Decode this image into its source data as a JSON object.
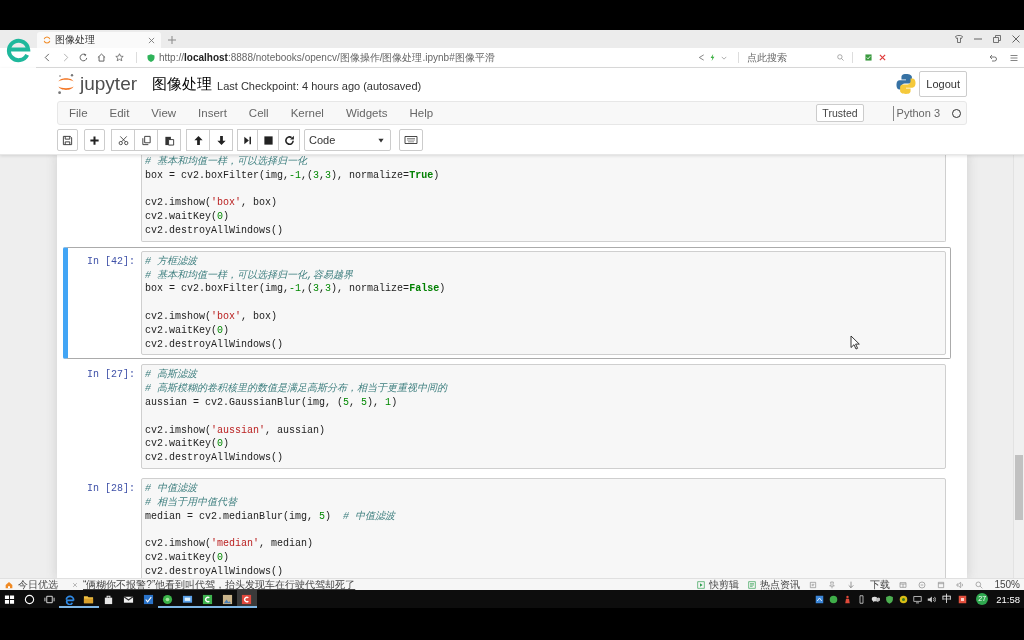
{
  "browser": {
    "tab": {
      "title": "图像处理"
    },
    "url": "http://**localhost**:8888/notebooks/opencv/图像操作/图像处理.ipynb#图像平滑",
    "search": {
      "placeholder": "点此搜索"
    }
  },
  "notebook": {
    "brand": "jupyter",
    "title": "图像处理",
    "checkpoint": "Last Checkpoint: 4 hours ago (autosaved)",
    "logout": "Logout",
    "menu": [
      "File",
      "Edit",
      "View",
      "Insert",
      "Cell",
      "Kernel",
      "Widgets",
      "Help"
    ],
    "trusted": "Trusted",
    "kernel": {
      "name": "Python 3",
      "busy": false
    },
    "cell_type": "Code"
  },
  "cells": [
    {
      "selected": false,
      "code": [
        [
          [
            {
              "kind": "comment",
              "text": "# 基本和均值一样，可以选择归一化"
            }
          ],
          [
            {
              "kind": "plain",
              "text": "box = cv2.boxFilter(img,"
            },
            {
              "kind": "number",
              "text": "-1"
            },
            {
              "kind": "plain",
              "text": ",("
            },
            {
              "kind": "number",
              "text": "3"
            },
            {
              "kind": "plain",
              "text": ","
            },
            {
              "kind": "number",
              "text": "3"
            },
            {
              "kind": "plain",
              "text": "), normalize="
            },
            {
              "kind": "keyword",
              "text": "True"
            },
            {
              "kind": "plain",
              "text": ")"
            }
          ]
        ],
        [
          [
            {
              "kind": "plain",
              "text": "cv2.imshow("
            },
            {
              "kind": "string",
              "text": "'box'"
            },
            {
              "kind": "plain",
              "text": ", box)"
            }
          ],
          [
            {
              "kind": "plain",
              "text": "cv2.waitKey("
            },
            {
              "kind": "number",
              "text": "0"
            },
            {
              "kind": "plain",
              "text": ")"
            }
          ],
          [
            {
              "kind": "plain",
              "text": "cv2.destroyAllWindows()"
            }
          ]
        ]
      ]
    },
    {
      "prompt": "In [42]:",
      "selected": true,
      "code": [
        [
          [
            {
              "kind": "comment",
              "text": "# 方框滤波"
            }
          ],
          [
            {
              "kind": "comment",
              "text": "# 基本和均值一样，可以选择归一化,容易越界"
            }
          ],
          [
            {
              "kind": "plain",
              "text": "box = cv2.boxFilter(img,"
            },
            {
              "kind": "number",
              "text": "-1"
            },
            {
              "kind": "plain",
              "text": ",("
            },
            {
              "kind": "number",
              "text": "3"
            },
            {
              "kind": "plain",
              "text": ","
            },
            {
              "kind": "number",
              "text": "3"
            },
            {
              "kind": "plain",
              "text": "), normalize="
            },
            {
              "kind": "keyword",
              "text": "False"
            },
            {
              "kind": "plain",
              "text": ")"
            }
          ]
        ],
        [
          [
            {
              "kind": "plain",
              "text": "cv2.imshow("
            },
            {
              "kind": "string",
              "text": "'box'"
            },
            {
              "kind": "plain",
              "text": ", box)"
            }
          ],
          [
            {
              "kind": "plain",
              "text": "cv2.waitKey("
            },
            {
              "kind": "number",
              "text": "0"
            },
            {
              "kind": "plain",
              "text": ")"
            }
          ],
          [
            {
              "kind": "plain",
              "text": "cv2.destroyAllWindows()"
            }
          ]
        ]
      ]
    },
    {
      "prompt": "In [27]:",
      "selected": false,
      "code": [
        [
          [
            {
              "kind": "comment",
              "text": "# 高斯滤波"
            }
          ],
          [
            {
              "kind": "comment",
              "text": "# 高斯模糊的卷积核里的数值是满足高斯分布，相当于更重视中间的"
            }
          ],
          [
            {
              "kind": "plain",
              "text": "aussian = cv2.GaussianBlur(img, ("
            },
            {
              "kind": "number",
              "text": "5"
            },
            {
              "kind": "plain",
              "text": ", "
            },
            {
              "kind": "number",
              "text": "5"
            },
            {
              "kind": "plain",
              "text": "), "
            },
            {
              "kind": "number",
              "text": "1"
            },
            {
              "kind": "plain",
              "text": ")"
            }
          ]
        ],
        [
          [
            {
              "kind": "plain",
              "text": "cv2.imshow("
            },
            {
              "kind": "string",
              "text": "'aussian'"
            },
            {
              "kind": "plain",
              "text": ", aussian)"
            }
          ],
          [
            {
              "kind": "plain",
              "text": "cv2.waitKey("
            },
            {
              "kind": "number",
              "text": "0"
            },
            {
              "kind": "plain",
              "text": ")"
            }
          ],
          [
            {
              "kind": "plain",
              "text": "cv2.destroyAllWindows()"
            }
          ]
        ]
      ]
    },
    {
      "prompt": "In [28]:",
      "selected": false,
      "code": [
        [
          [
            {
              "kind": "comment",
              "text": "# 中值滤波"
            }
          ],
          [
            {
              "kind": "comment",
              "text": "# 相当于用中值代替"
            }
          ],
          [
            {
              "kind": "plain",
              "text": "median = cv2.medianBlur(img, "
            },
            {
              "kind": "number",
              "text": "5"
            },
            {
              "kind": "plain",
              "text": ")  "
            },
            {
              "kind": "comment",
              "text": "# 中值滤波"
            }
          ]
        ],
        [
          [
            {
              "kind": "plain",
              "text": "cv2.imshow("
            },
            {
              "kind": "string",
              "text": "'median'"
            },
            {
              "kind": "plain",
              "text": ", median)"
            }
          ],
          [
            {
              "kind": "plain",
              "text": "cv2.waitKey("
            },
            {
              "kind": "number",
              "text": "0"
            },
            {
              "kind": "plain",
              "text": ")"
            }
          ],
          [
            {
              "kind": "plain",
              "text": "cv2.destroyAllWindows()"
            }
          ]
        ]
      ]
    }
  ],
  "status_bar": {
    "feed": "今日优选",
    "news": "“俩糊你不报警?”他看到叫代驾，抬头发现车在行驶代驾却死了",
    "items": [
      "快剪辑",
      "热点资讯",
      "下载"
    ],
    "zoom": "150%"
  },
  "taskbar": {
    "apps": [
      {
        "running": true,
        "selected": false
      },
      {
        "running": true,
        "selected": false
      },
      {
        "running": false,
        "selected": false
      },
      {
        "running": false,
        "selected": false
      },
      {
        "running": false,
        "selected": false
      },
      {
        "running": true,
        "selected": false
      },
      {
        "running": true,
        "selected": false
      },
      {
        "running": true,
        "selected": false
      },
      {
        "running": true,
        "selected": false
      },
      {
        "running": true,
        "selected": true
      }
    ],
    "ime": "中",
    "badge": "27",
    "time": "21:58"
  }
}
